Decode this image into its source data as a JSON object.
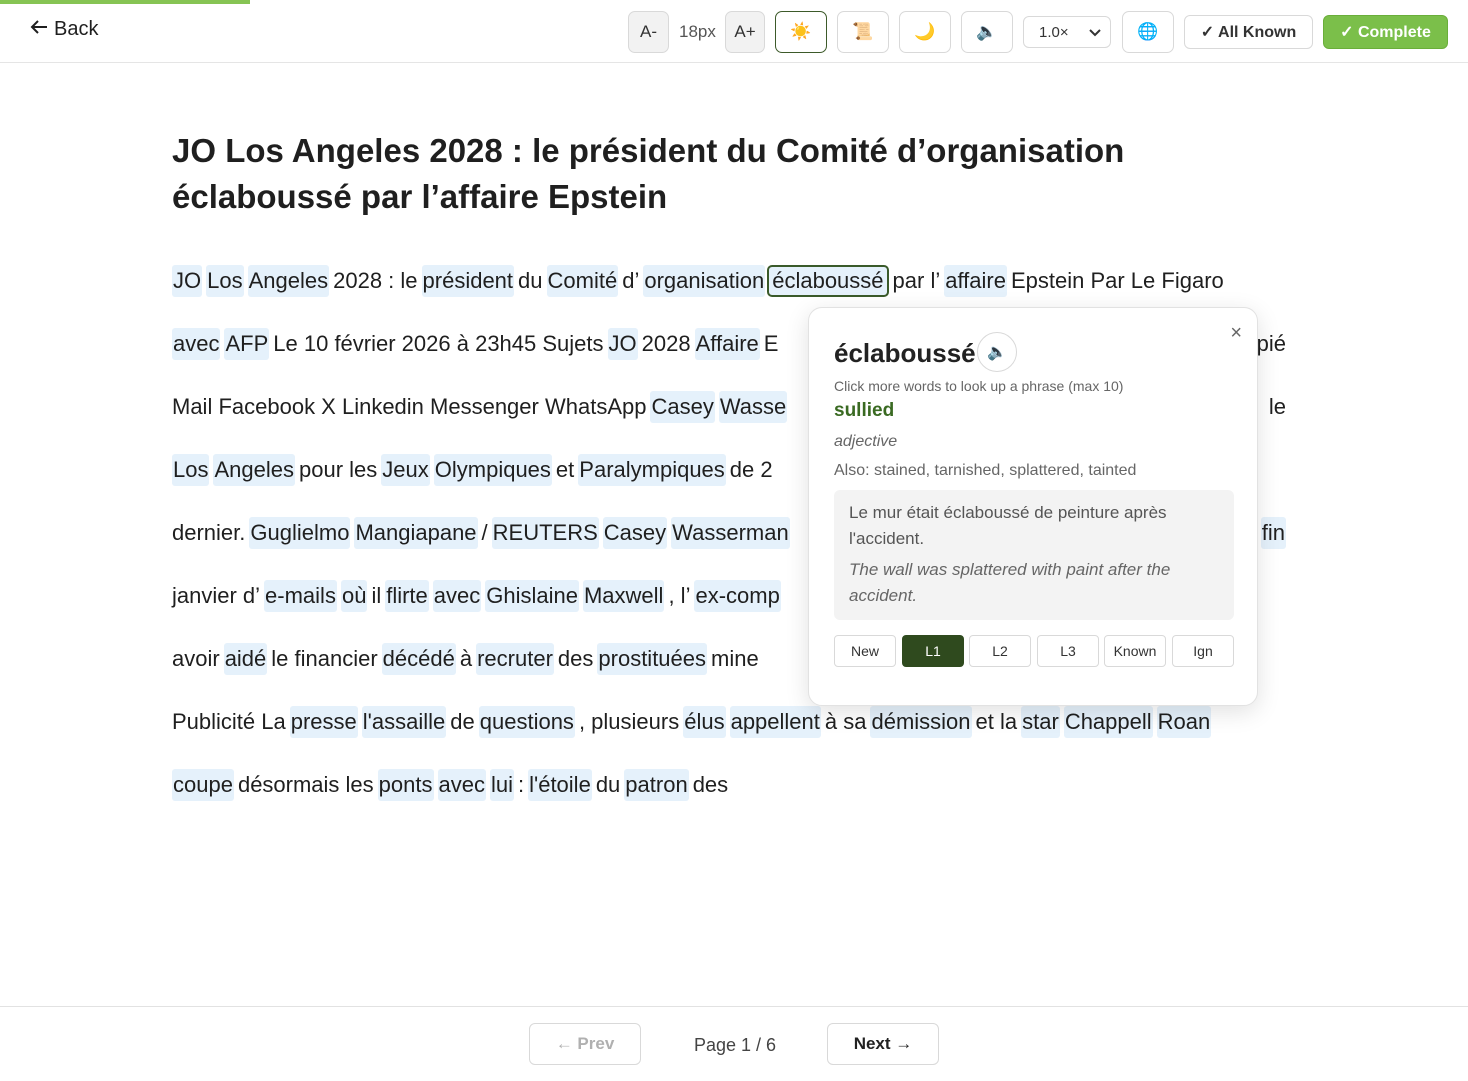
{
  "progress": {
    "percent": 17
  },
  "toolbar": {
    "back_label": "Back",
    "back_icon": "arrow-left-icon",
    "font_decrease_label": "A-",
    "font_size_label": "18px",
    "font_increase_label": "A+",
    "theme_light_icon": "☀️",
    "theme_sepia_icon": "📜",
    "theme_dark_icon": "🌙",
    "speaker_icon": "🔈",
    "speed_value": "1.0×",
    "translate_icon": "🌐",
    "all_known_label": "✓ All Known",
    "complete_label": "✓ Complete",
    "complete_color": "#7bbf4a"
  },
  "article": {
    "title_line1": "JO Los Angeles 2028 : le président du Comité d’organisation",
    "title_line2": "éclaboussé par l’affaire Epstein",
    "lines": [
      [
        {
          "t": "JO",
          "h": true
        },
        {
          "t": "Los",
          "h": true
        },
        {
          "t": "Angeles",
          "h": true
        },
        {
          "t": "2028 : le",
          "h": false
        },
        {
          "t": "président",
          "h": true
        },
        {
          "t": "du",
          "h": false
        },
        {
          "t": "Comité",
          "h": true
        },
        {
          "t": "d’",
          "h": false
        },
        {
          "t": "organisation",
          "h": true
        },
        {
          "t": "éclaboussé",
          "h": true,
          "sel": true
        },
        {
          "t": "par l’",
          "h": false
        },
        {
          "t": "affaire",
          "h": true
        },
        {
          "t": "Epstein Par Le Figaro",
          "h": false
        }
      ],
      [
        {
          "t": "avec",
          "h": true
        },
        {
          "t": "AFP",
          "h": true
        },
        {
          "t": "Le 10 février 2026 à 23h45 Sujets",
          "h": false
        },
        {
          "t": "JO",
          "h": true
        },
        {
          "t": "2028",
          "h": false
        },
        {
          "t": "Affaire",
          "h": true
        },
        {
          "t": "E",
          "h": false
        }
      ],
      [
        {
          "t": "Mail Facebook X Linkedin Messenger WhatsApp",
          "h": false
        },
        {
          "t": "Casey",
          "h": true
        },
        {
          "t": "Wasse",
          "h": true
        }
      ],
      [
        {
          "t": "Los",
          "h": true
        },
        {
          "t": "Angeles",
          "h": true
        },
        {
          "t": "pour les",
          "h": false
        },
        {
          "t": "Jeux",
          "h": true
        },
        {
          "t": "Olympiques",
          "h": true
        },
        {
          "t": "et",
          "h": false
        },
        {
          "t": "Paralympiques",
          "h": true
        },
        {
          "t": "de 2",
          "h": false
        }
      ],
      [
        {
          "t": "dernier.",
          "h": false
        },
        {
          "t": "Guglielmo",
          "h": true
        },
        {
          "t": "Mangiapane",
          "h": true
        },
        {
          "t": "/",
          "h": false
        },
        {
          "t": "REUTERS",
          "h": true
        },
        {
          "t": "Casey",
          "h": true
        },
        {
          "t": "Wasserman",
          "h": true
        }
      ],
      [
        {
          "t": "janvier d’",
          "h": false
        },
        {
          "t": "e-mails",
          "h": true
        },
        {
          "t": "où",
          "h": true
        },
        {
          "t": "il",
          "h": false
        },
        {
          "t": "flirte",
          "h": true
        },
        {
          "t": "avec",
          "h": true
        },
        {
          "t": "Ghislaine",
          "h": true
        },
        {
          "t": "Maxwell",
          "h": true
        },
        {
          "t": ", l’",
          "h": false
        },
        {
          "t": "ex-comp",
          "h": true
        }
      ],
      [
        {
          "t": "avoir",
          "h": false
        },
        {
          "t": "aidé",
          "h": true
        },
        {
          "t": "le financier",
          "h": false
        },
        {
          "t": "décédé",
          "h": true
        },
        {
          "t": "à",
          "h": false
        },
        {
          "t": "recruter",
          "h": true
        },
        {
          "t": "des",
          "h": false
        },
        {
          "t": "prostituées",
          "h": true
        },
        {
          "t": "mine",
          "h": false
        }
      ],
      [
        {
          "t": "Publicité La",
          "h": false
        },
        {
          "t": "presse",
          "h": true
        },
        {
          "t": "l'assaille",
          "h": true
        },
        {
          "t": "de",
          "h": false
        },
        {
          "t": "questions",
          "h": true
        },
        {
          "t": ", plusieurs",
          "h": false
        },
        {
          "t": "élus",
          "h": true
        },
        {
          "t": "appellent",
          "h": true
        },
        {
          "t": "à sa",
          "h": false
        },
        {
          "t": "démission",
          "h": true
        },
        {
          "t": "et la",
          "h": false
        },
        {
          "t": "star",
          "h": true
        },
        {
          "t": "Chappell",
          "h": true
        },
        {
          "t": "Roan",
          "h": true
        }
      ],
      [
        {
          "t": "coupe",
          "h": true
        },
        {
          "t": "désormais les",
          "h": false
        },
        {
          "t": "ponts",
          "h": true
        },
        {
          "t": "avec",
          "h": true
        },
        {
          "t": "lui",
          "h": true
        },
        {
          "t": ":",
          "h": false
        },
        {
          "t": "l'étoile",
          "h": true
        },
        {
          "t": "du",
          "h": false
        },
        {
          "t": "patron",
          "h": true
        },
        {
          "t": "des",
          "h": false
        }
      ]
    ],
    "right_fragments": [
      {
        "line": 1,
        "t": "pié",
        "h": false
      },
      {
        "line": 2,
        "t": "le",
        "h": false
      },
      {
        "line": 4,
        "t": "fin",
        "h": true
      }
    ]
  },
  "popup": {
    "headword": "éclaboussé",
    "speak_icon": "🔈",
    "close_label": "×",
    "hint": "Click more words to look up a phrase (max 10)",
    "translation": "sullied",
    "part_of_speech": "adjective",
    "also": "Also: stained, tarnished, splattered, tainted",
    "example_fr": "Le mur était éclaboussé de peinture après l'accident.",
    "example_en": "The wall was splattered with paint after the accident.",
    "levels": [
      "New",
      "L1",
      "L2",
      "L3",
      "Known",
      "Ign"
    ],
    "active_level": "L1"
  },
  "pager": {
    "prev_label": "← Prev",
    "page_label": "Page 1 / 6",
    "next_label": "Next →"
  }
}
